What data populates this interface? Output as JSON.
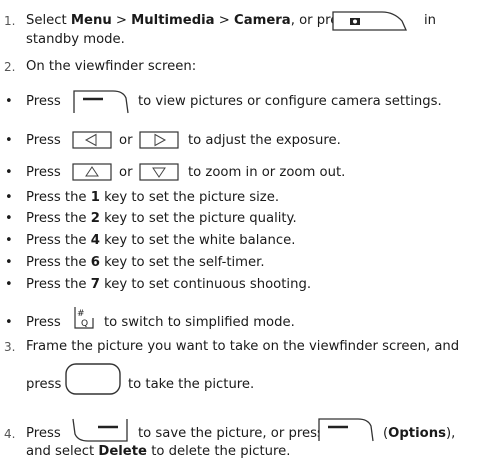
{
  "steps": {
    "s1": {
      "num": "1.",
      "a": "Select ",
      "menu": "Menu",
      "gt1": " > ",
      "multimedia": "Multimedia",
      "gt2": " > ",
      "camera": "Camera",
      "b": ", or press",
      "c": "in",
      "cont": "standby mode."
    },
    "s2": {
      "num": "2.",
      "text": "On the viewfinder screen:"
    },
    "s3": {
      "num": "3.",
      "text": "Frame the picture you want to take on the viewfinder screen, and",
      "press": "press",
      "after": "to take the picture."
    },
    "s4": {
      "num": "4.",
      "press": "Press",
      "a": "to save the picture, or press",
      "options_open": "(",
      "options": "Options",
      "options_close": "),",
      "cont_a": "and select ",
      "delete": "Delete",
      "cont_b": " to delete the picture."
    }
  },
  "bullets": [
    {
      "press": "Press",
      "text": "to view pictures or configure camera settings."
    },
    {
      "press": "Press",
      "or": "or",
      "text": "to adjust the exposure."
    },
    {
      "press": "Press",
      "or": "or",
      "text": "to zoom in or zoom out."
    },
    {
      "pre": "Press the ",
      "key": "1",
      "post": " key to set the picture size."
    },
    {
      "pre": "Press the ",
      "key": "2",
      "post": " key to set the picture quality."
    },
    {
      "pre": "Press the ",
      "key": "4",
      "post": " key to set the white balance."
    },
    {
      "pre": "Press the ",
      "key": "6",
      "post": " key to set the self-timer."
    },
    {
      "pre": "Press the ",
      "key": "7",
      "post": " key to set continuous shooting."
    },
    {
      "press": "Press",
      "text": "to switch to simplified mode."
    }
  ],
  "icons": {
    "camera_key": "camera-key-icon",
    "left_soft": "left-soft-key-icon",
    "right_soft": "right-soft-key-icon",
    "left_nav": "left-arrow-key-icon",
    "right_nav": "right-arrow-key-icon",
    "up_nav": "up-arrow-key-icon",
    "down_nav": "down-arrow-key-icon",
    "hash_key": "hash-key-icon",
    "center_key": "center-key-icon"
  },
  "bullet_glyph": "•"
}
